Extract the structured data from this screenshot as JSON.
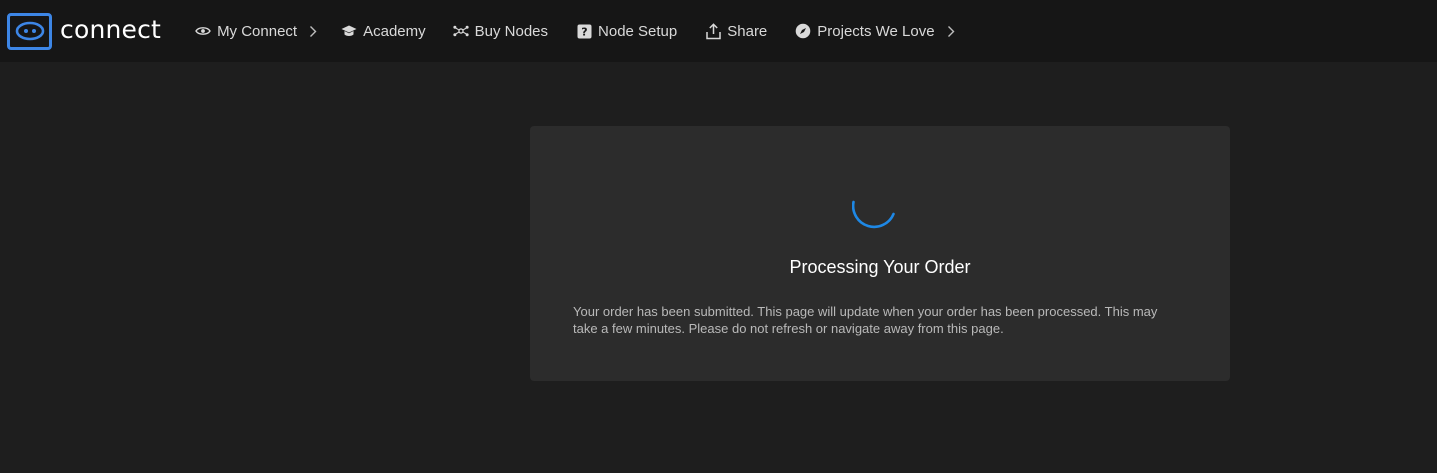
{
  "brand": {
    "name": "connect",
    "accent": "#3d86e6"
  },
  "nav": {
    "items": [
      {
        "label": "My Connect",
        "icon": "eye-icon",
        "has_chevron": true
      },
      {
        "label": "Academy",
        "icon": "graduation-cap-icon",
        "has_chevron": false
      },
      {
        "label": "Buy Nodes",
        "icon": "nodes-icon",
        "has_chevron": false
      },
      {
        "label": "Node Setup",
        "icon": "question-square-icon",
        "has_chevron": false
      },
      {
        "label": "Share",
        "icon": "share-upload-icon",
        "has_chevron": false
      },
      {
        "label": "Projects We Love",
        "icon": "compass-icon",
        "has_chevron": true
      }
    ]
  },
  "order_status": {
    "title": "Processing Your Order",
    "message": "Your order has been submitted. This page will update when your order has been processed. This may take a few minutes. Please do not refresh or navigate away from this page.",
    "spinner_color": "#1e88e5"
  },
  "colors": {
    "topbar_bg": "#161616",
    "page_bg": "#1e1e1e",
    "card_bg": "#2c2c2c"
  }
}
